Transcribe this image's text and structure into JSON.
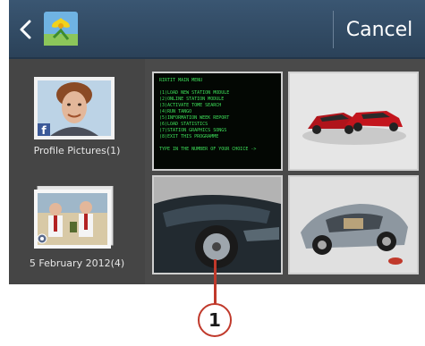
{
  "header": {
    "back_icon": "chevron-left-icon",
    "app_icon": "gallery-flower-icon",
    "cancel_label": "Cancel"
  },
  "albums": [
    {
      "label": "Profile Pictures(1)",
      "badge_icon": "facebook-icon"
    },
    {
      "label": "5 February 2012(4)",
      "badge_icon": "camera-icon"
    }
  ],
  "terminal": {
    "lines": [
      "RIRTIT MAIN MENU",
      "",
      "(1)LOAD NEW STATION MODULE",
      "(2)ONLINE STATION MODULE",
      "(3)ACTIVATE TOME SEARCH",
      "(4)RUN TANGO",
      "(5)INFORMATION WEEK REPORT",
      "(6)LOAD STATISTICS",
      "(7)STATION GRAPHICS SONGS",
      "(8)EXIT THIS PROGRAMME",
      "",
      "TYPE IN THE NUMBER OF YOUR CHOICE ->"
    ]
  },
  "callout": {
    "number": "1"
  },
  "colors": {
    "accent": "#c0392b",
    "topbar": "#2f4760"
  }
}
